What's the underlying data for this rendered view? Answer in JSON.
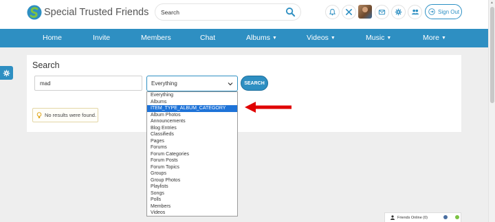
{
  "header": {
    "site_title": "Special Trusted Friends",
    "search_placeholder": "Search",
    "signout_label": "Sign Out"
  },
  "nav": {
    "items": [
      {
        "label": "Home"
      },
      {
        "label": "Invite"
      },
      {
        "label": "Members"
      },
      {
        "label": "Chat"
      },
      {
        "label": "Albums",
        "has_dropdown": true
      },
      {
        "label": "Videos",
        "has_dropdown": true
      },
      {
        "label": "Music",
        "has_dropdown": true
      },
      {
        "label": "More",
        "has_dropdown": true
      }
    ]
  },
  "search": {
    "title": "Search",
    "query_value": "mad",
    "selected_type": "Everything",
    "button_label": "SEARCH",
    "no_results": "No results were found."
  },
  "dropdown": {
    "options": [
      "Everything",
      "Albums",
      "ITEM_TYPE_ALBUM_CATEGORY",
      "Album Photos",
      "Announcements",
      "Blog Entries",
      "Classifieds",
      "Pages",
      "Forums",
      "Forum Categories",
      "Forum Posts",
      "Forum Topics",
      "Groups",
      "Group Photos",
      "Playlists",
      "Songs",
      "Polls",
      "Members",
      "Videos"
    ],
    "highlighted": "ITEM_TYPE_ALBUM_CATEGORY"
  },
  "friends_online": {
    "label": "Friends Online (0)"
  },
  "colors": {
    "brand_blue": "#2e8fc2",
    "highlight_blue": "#1e73d8",
    "annotation_red": "#e00000"
  },
  "icons": {
    "header": [
      "bell-icon",
      "tools-icon",
      "mail-icon",
      "gear-icon",
      "users-icon",
      "sign-out-icon"
    ],
    "search": "search-icon",
    "side": "gear-icon"
  }
}
